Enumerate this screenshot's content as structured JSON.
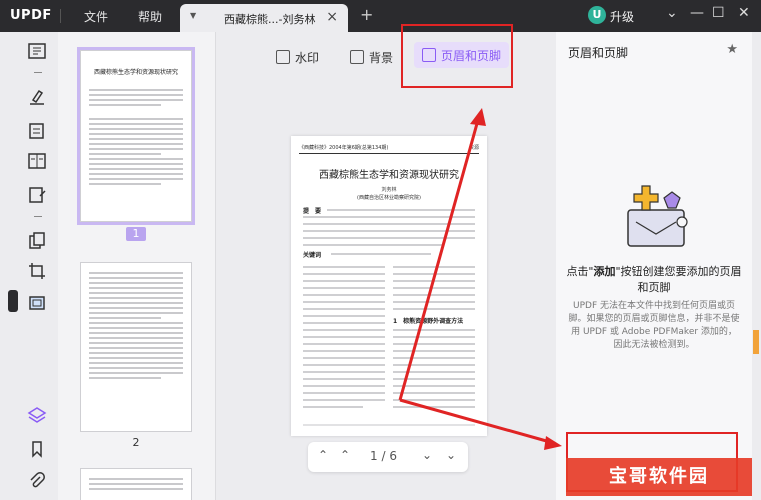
{
  "app": {
    "logo": "UPDF",
    "menu": {
      "file": "文件",
      "help": "帮助"
    },
    "tab": {
      "title": "西藏棕熊...-刘务林",
      "close": "×"
    },
    "new_tab": "+",
    "upgrade": {
      "avatar": "U",
      "label": "升级"
    },
    "window_controls": {
      "menu": "⌄",
      "minimize": "—",
      "maximize": "☐",
      "close": "✕"
    }
  },
  "thumbnails": {
    "pages": [
      {
        "number": "1",
        "title": "西藏棕熊生态学和资源现状研究",
        "selected": true
      },
      {
        "number": "2",
        "selected": false
      }
    ]
  },
  "toolbar": {
    "watermark": "水印",
    "background": "背景",
    "header_footer": "页眉和页脚"
  },
  "document": {
    "header_left": "《西藏科技》2004年第6期(总第134期)",
    "header_right": "资源",
    "title": "西藏棕熊生态学和资源现状研究",
    "author": "刘务林",
    "affiliation": "(西藏自治区林业勘察研究院)",
    "abstract_label": "提　要",
    "keywords_label": "关键词",
    "section_title": "1　棕熊资源野外调查方法"
  },
  "pager": {
    "first": "⌃",
    "prev": "⌃",
    "current": "1",
    "separator": "/",
    "total": "6",
    "next": "⌄",
    "last": "⌄"
  },
  "right_panel": {
    "title": "页眉和页脚",
    "headline_prefix": "点击\"",
    "headline_bold": "添加",
    "headline_suffix": "\"按钮创建您要添加的页眉和页脚",
    "description": "UPDF 无法在本文件中找到任何页眉或页脚。如果您的页眉或页脚信息，并非不是使用 UPDF 或 Adobe PDFMaker 添加的，因此无法被检测到。"
  },
  "watermark_overlay": "宝哥软件园",
  "colors": {
    "accent": "#8a5cf5",
    "annotation_red": "#e02424",
    "titlebar": "#2b2b2e"
  }
}
